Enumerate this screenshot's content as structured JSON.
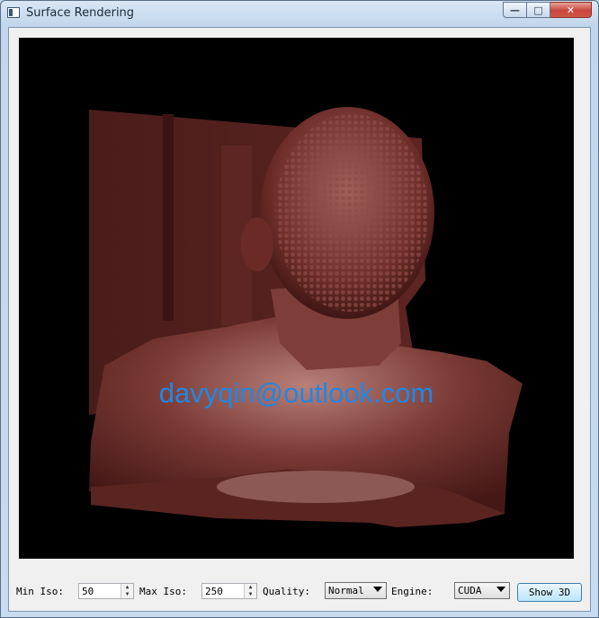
{
  "window": {
    "title": "Surface Rendering",
    "caption_buttons": [
      "minimize-icon",
      "maximize-icon",
      "close-icon"
    ]
  },
  "viewport": {
    "background": "#000000",
    "surface_color": "#6b2a27",
    "watermark": "davyqin@outlook.com",
    "watermark_color": "#1e88e5"
  },
  "controls": {
    "min_iso_label": "Min Iso:",
    "min_iso_value": "50",
    "max_iso_label": "Max Iso:",
    "max_iso_value": "250",
    "quality_label": "Quality:",
    "quality_value": "Normal",
    "engine_label": "Engine:",
    "engine_value": "CUDA",
    "show_button": "Show 3D"
  }
}
